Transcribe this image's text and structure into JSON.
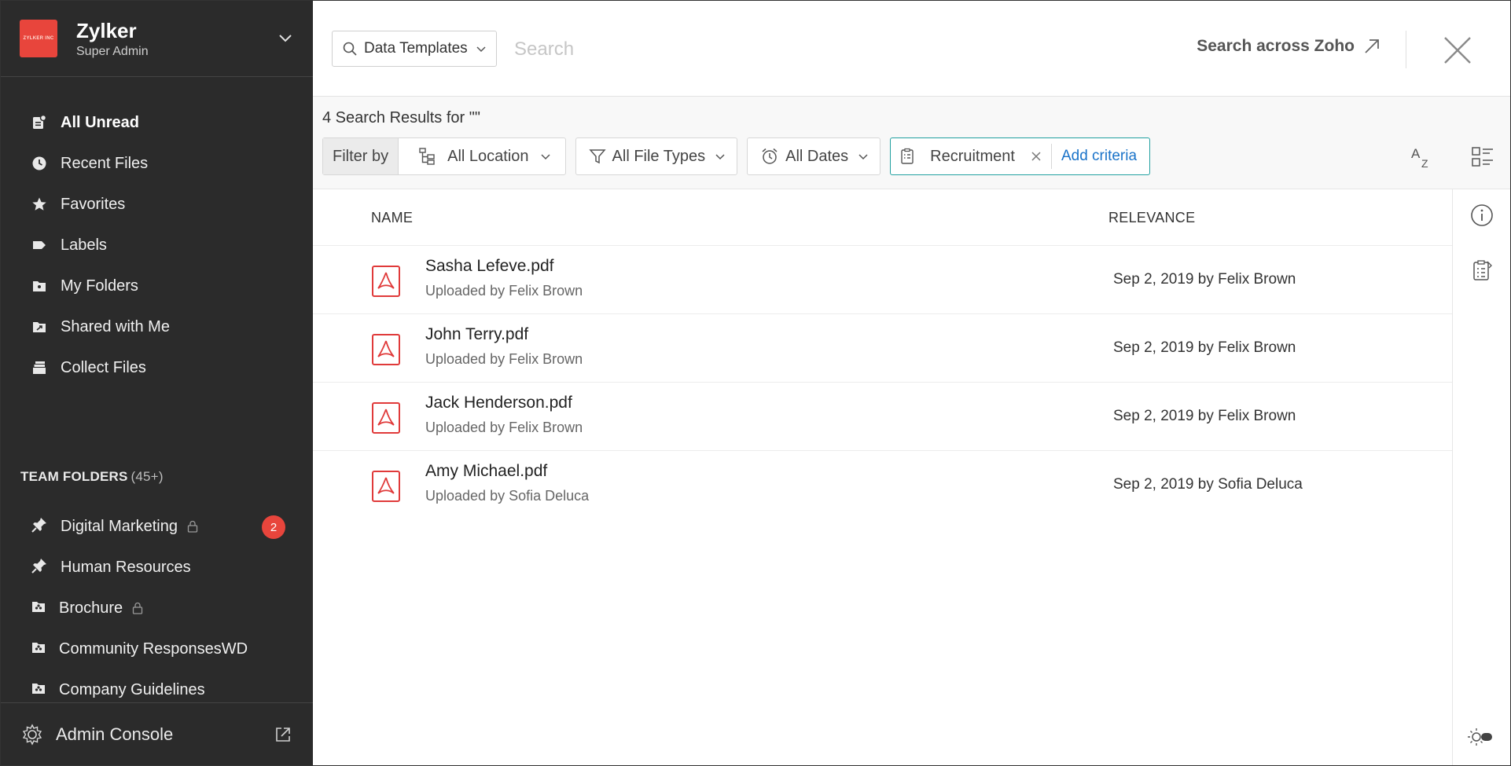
{
  "org": {
    "name": "Zylker",
    "role": "Super Admin",
    "logo_text": "ZYLKER INC"
  },
  "nav": [
    {
      "label": "All Unread",
      "icon": "unread-icon",
      "active": true
    },
    {
      "label": "Recent Files",
      "icon": "clock-icon"
    },
    {
      "label": "Favorites",
      "icon": "star-icon"
    },
    {
      "label": "Labels",
      "icon": "label-icon"
    },
    {
      "label": "My Folders",
      "icon": "folder-icon"
    },
    {
      "label": "Shared with Me",
      "icon": "shared-folder-icon"
    },
    {
      "label": "Collect Files",
      "icon": "collect-files-icon"
    }
  ],
  "team_folders": {
    "heading": "TEAM FOLDERS",
    "count": "(45+)",
    "items": [
      {
        "label": "Digital Marketing",
        "icon": "pin-icon",
        "locked": true,
        "badge": "2"
      },
      {
        "label": "Human Resources",
        "icon": "pin-icon"
      },
      {
        "label": "Brochure",
        "icon": "team-folder-icon",
        "locked": true
      },
      {
        "label": "Community ResponsesWD",
        "icon": "team-folder-icon"
      },
      {
        "label": "Company Guidelines",
        "icon": "team-folder-icon"
      }
    ]
  },
  "admin": {
    "label": "Admin Console"
  },
  "search": {
    "scope_label": "Data Templates",
    "placeholder": "Search",
    "across_label": "Search across Zoho"
  },
  "results": {
    "count_label": "4 Search Results for \"\""
  },
  "filters": {
    "filter_by_label": "Filter by",
    "location": "All Location",
    "file_types": "All File Types",
    "dates": "All Dates",
    "criteria_tag": "Recruitment",
    "add_criteria": "Add criteria"
  },
  "table": {
    "columns": {
      "name": "NAME",
      "relevance": "RELEVANCE"
    },
    "rows": [
      {
        "name": "Sasha Lefeve.pdf",
        "sub": "Uploaded by Felix Brown",
        "relevance": "Sep 2, 2019 by Felix Brown"
      },
      {
        "name": "John Terry.pdf",
        "sub": "Uploaded by Felix Brown",
        "relevance": "Sep 2, 2019 by Felix Brown"
      },
      {
        "name": "Jack Henderson.pdf",
        "sub": "Uploaded by Felix Brown",
        "relevance": "Sep 2, 2019 by Felix Brown"
      },
      {
        "name": "Amy Michael.pdf",
        "sub": "Uploaded by Sofia Deluca",
        "relevance": "Sep 2, 2019 by Sofia Deluca"
      }
    ]
  },
  "colors": {
    "sidebar_bg": "#2b2b2b",
    "accent_red": "#e8453c",
    "criteria_border": "#21a0a0",
    "link_blue": "#1a73c9"
  }
}
